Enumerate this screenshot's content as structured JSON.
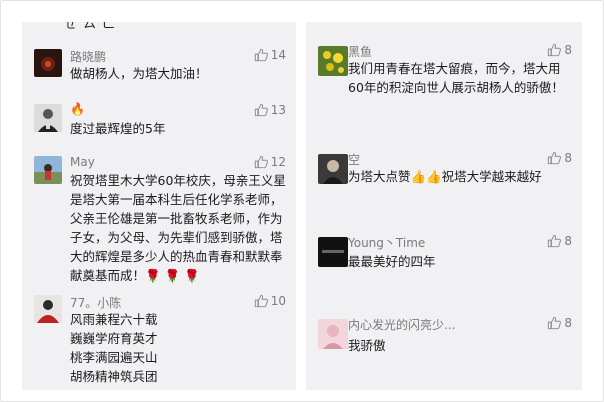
{
  "left_panel": {
    "top_fragment": "ㄝ  ㄙ  ㄈ",
    "comments": [
      {
        "name": "路晓鹏",
        "lines": [
          "做胡杨人，为塔大加油！"
        ],
        "likes": "14",
        "avatar": "dark-fire"
      },
      {
        "name": "🔥",
        "lines": [
          "度过最辉煌的5年"
        ],
        "likes": "13",
        "avatar": "man-suit"
      },
      {
        "name": "May",
        "lines": [
          "祝贺塔里木大学60年校庆，母亲王义星",
          "是塔大第一届本科生后任化学系老师，",
          "父亲王伦雄是第一批畜牧系老师，作为",
          "子女，为父母、为先辈们感到骄傲，塔",
          "大的辉煌是多少人的热血青春和默默奉",
          "献奠基而成！🌹 🌹 🌹"
        ],
        "likes": "12",
        "avatar": "outdoor"
      },
      {
        "name": "77。小陈",
        "lines": [
          "风雨兼程六十载",
          "巍巍学府育英才",
          "桃李满园遍天山",
          "胡杨精神筑兵团"
        ],
        "likes": "10",
        "avatar": "person-red"
      }
    ]
  },
  "right_panel": {
    "comments": [
      {
        "name": "黑鱼",
        "lines": [
          "我们用青春在塔大留痕，而今，塔大用",
          "60年的积淀向世人展示胡杨人的骄傲！"
        ],
        "likes": "8",
        "avatar": "yellow-flowers"
      },
      {
        "name": "空",
        "lines": [
          "为塔大点赞👍👍祝塔大学越来越好"
        ],
        "likes": "8",
        "avatar": "dark-portrait"
      },
      {
        "name": "Young丶Time",
        "lines": [
          "最最美好的四年"
        ],
        "likes": "8",
        "avatar": "black-text"
      },
      {
        "name": "内心发光的闪亮少...",
        "lines": [
          "我骄傲"
        ],
        "likes": "8",
        "avatar": "pink"
      }
    ]
  },
  "colors": {
    "panel_bg": "#f1f1f4",
    "name_gray": "#7a7a7a",
    "text": "#1b1b1b"
  },
  "icons": {
    "like": "thumbs-up-icon"
  }
}
